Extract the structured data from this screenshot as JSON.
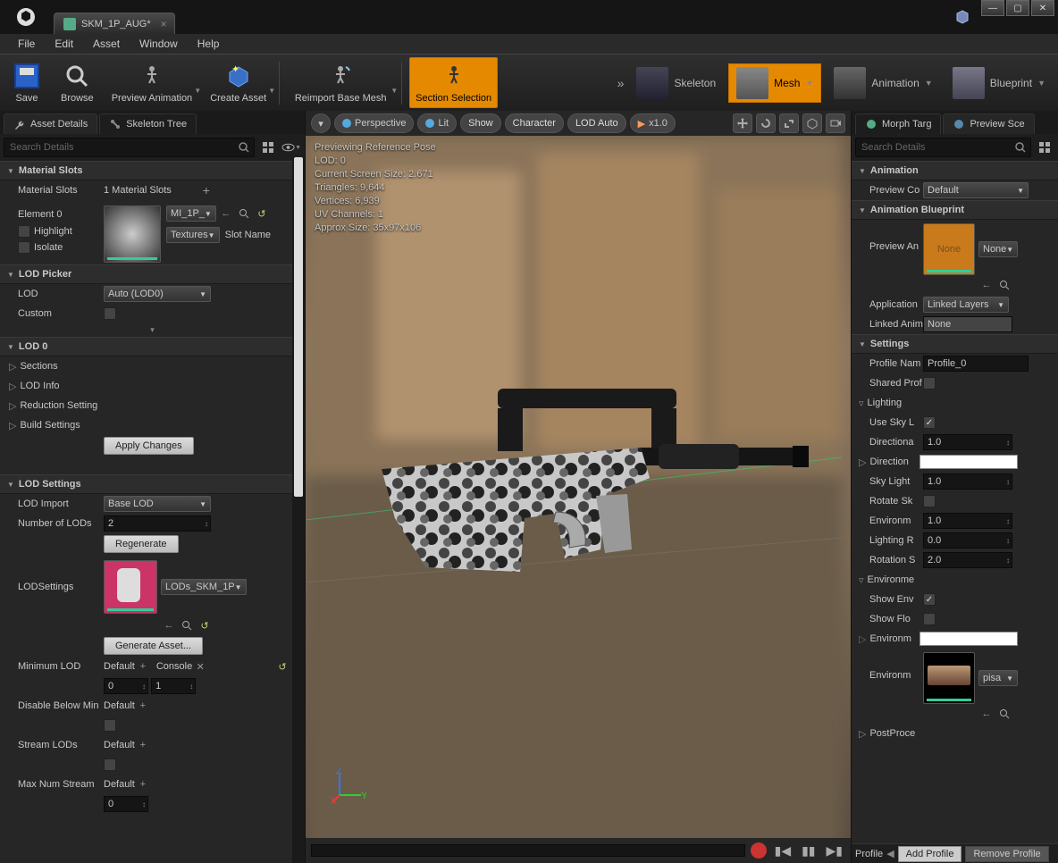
{
  "tabTitle": "SKM_1P_AUG*",
  "menu": [
    "File",
    "Edit",
    "Asset",
    "Window",
    "Help"
  ],
  "toolbar": {
    "save": "Save",
    "browse": "Browse",
    "preview": "Preview Animation",
    "createAsset": "Create Asset",
    "reimport": "Reimport Base Mesh",
    "section": "Section Selection"
  },
  "modes": {
    "skeleton": "Skeleton",
    "mesh": "Mesh",
    "animation": "Animation",
    "blueprint": "Blueprint"
  },
  "leftTabs": {
    "asset": "Asset Details",
    "skeleton": "Skeleton Tree"
  },
  "searchPlaceholder": "Search Details",
  "materialSlots": {
    "header": "Material Slots",
    "label": "Material Slots",
    "count": "1 Material Slots",
    "element": "Element 0",
    "highlight": "Highlight",
    "isolate": "Isolate",
    "matName": "MI_1P_",
    "textures": "Textures",
    "slotName": "Slot Name"
  },
  "lodPicker": {
    "header": "LOD Picker",
    "lod": "LOD",
    "lodVal": "Auto (LOD0)",
    "custom": "Custom"
  },
  "lod0": {
    "header": "LOD 0",
    "sections": "Sections",
    "info": "LOD Info",
    "reduction": "Reduction Setting",
    "build": "Build Settings",
    "apply": "Apply Changes"
  },
  "lodSettings": {
    "header": "LOD Settings",
    "import": "LOD Import",
    "importVal": "Base LOD",
    "num": "Number of LODs",
    "numVal": "2",
    "regen": "Regenerate",
    "lodset": "LODSettings",
    "lodsetVal": "LODs_SKM_1P",
    "genAsset": "Generate Asset...",
    "minLod": "Minimum LOD",
    "default": "Default",
    "console": "Console",
    "minA": "0",
    "minB": "1",
    "disable": "Disable Below Min",
    "stream": "Stream LODs",
    "maxnum": "Max Num Stream",
    "maxVal": "0"
  },
  "viewportTools": {
    "persp": "Perspective",
    "lit": "Lit",
    "show": "Show",
    "char": "Character",
    "lodAuto": "LOD Auto",
    "speed": "x1.0"
  },
  "overlay": {
    "l1": "Previewing Reference Pose",
    "l2": "LOD: 0",
    "l3": "Current Screen Size: 2.671",
    "l4": "Triangles: 9,644",
    "l5": "Vertices: 6,939",
    "l6": "UV Channels: 1",
    "l7": "Approx Size: 35x97x106"
  },
  "rightTabs": {
    "morph": "Morph Targ",
    "preview": "Preview Sce"
  },
  "anim": {
    "header": "Animation",
    "previewCo": "Preview Co",
    "previewVal": "Default",
    "bpHeader": "Animation Blueprint",
    "previewAn": "Preview An",
    "noneThumb": "None",
    "noneSel": "None",
    "app": "Application",
    "appVal": "Linked Layers",
    "linked": "Linked Anim",
    "linkedVal": "None"
  },
  "settings": {
    "header": "Settings",
    "profile": "Profile Nam",
    "profileVal": "Profile_0",
    "shared": "Shared Prof",
    "lighting": "Lighting",
    "sky": "Use Sky L",
    "dir": "Directiona",
    "dirVal": "1.0",
    "dir2": "Direction",
    "skyl": "Sky Light",
    "skylVal": "1.0",
    "rotate": "Rotate Sk",
    "env": "Environm",
    "envVal": "1.0",
    "lightr": "Lighting R",
    "lightrVal": "0.0",
    "rot": "Rotation S",
    "rotVal": "2.0",
    "envH": "Environme",
    "showEnv": "Show Env",
    "showFlo": "Show Flo",
    "envm": "Environm",
    "envm2": "Environm",
    "pisa": "pisa",
    "post": "PostProce"
  },
  "profileBar": {
    "label": "Profile",
    "add": "Add Profile",
    "remove": "Remove Profile"
  }
}
